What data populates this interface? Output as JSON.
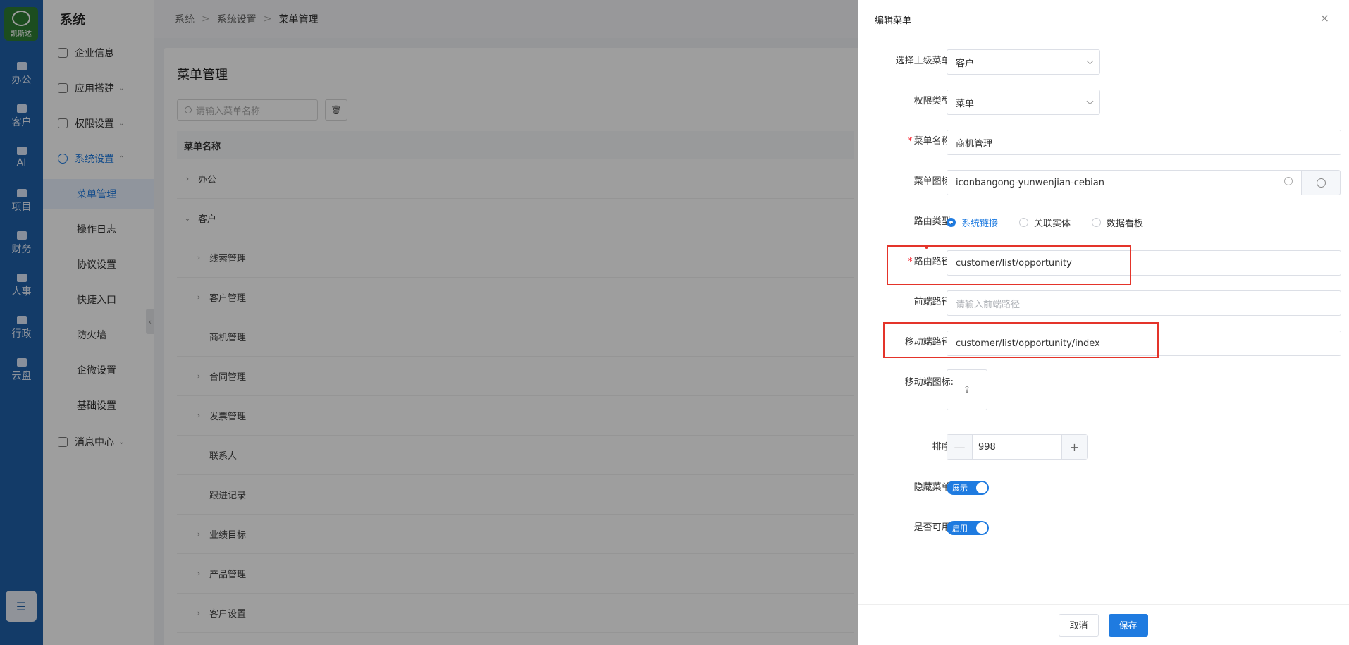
{
  "rail": {
    "logo_text": "凯斯达",
    "items": [
      {
        "label": "办公",
        "icon": "office-icon"
      },
      {
        "label": "客户",
        "icon": "customer-icon"
      },
      {
        "label": "AI",
        "icon": "ai-icon"
      },
      {
        "label": "项目",
        "icon": "folder-icon"
      },
      {
        "label": "财务",
        "icon": "finance-icon"
      },
      {
        "label": "人事",
        "icon": "badge-icon"
      },
      {
        "label": "行政",
        "icon": "admin-icon"
      },
      {
        "label": "云盘",
        "icon": "cloud-icon"
      }
    ],
    "bottom_icon": "menu-config-icon"
  },
  "sidebar": {
    "title": "系统",
    "items": [
      {
        "label": "企业信息",
        "icon": "building-icon"
      },
      {
        "label": "应用搭建",
        "icon": "app-icon",
        "chevron": "⌄"
      },
      {
        "label": "权限设置",
        "icon": "permission-icon",
        "chevron": "⌄"
      },
      {
        "label": "系统设置",
        "icon": "settings-icon",
        "chevron": "⌃"
      },
      {
        "label": "菜单管理"
      },
      {
        "label": "操作日志"
      },
      {
        "label": "协议设置"
      },
      {
        "label": "快捷入口"
      },
      {
        "label": "防火墙"
      },
      {
        "label": "企微设置"
      },
      {
        "label": "基础设置"
      },
      {
        "label": "消息中心",
        "icon": "message-icon",
        "chevron": "⌄"
      }
    ]
  },
  "breadcrumb": {
    "items": [
      "系统",
      "系统设置",
      "菜单管理"
    ],
    "sep": ">"
  },
  "main": {
    "title": "菜单管理",
    "search_placeholder": "请输入菜单名称",
    "column_header": "菜单名称",
    "rows": [
      {
        "label": "办公",
        "arrow": "›"
      },
      {
        "label": "客户",
        "arrow": "⌄"
      },
      {
        "label": "线索管理",
        "arrow": "›"
      },
      {
        "label": "客户管理",
        "arrow": "›"
      },
      {
        "label": "商机管理",
        "arrow": ""
      },
      {
        "label": "合同管理",
        "arrow": "›"
      },
      {
        "label": "发票管理",
        "arrow": "›"
      },
      {
        "label": "联系人",
        "arrow": ""
      },
      {
        "label": "跟进记录",
        "arrow": ""
      },
      {
        "label": "业绩目标",
        "arrow": "›"
      },
      {
        "label": "产品管理",
        "arrow": "›"
      },
      {
        "label": "客户设置",
        "arrow": "›"
      }
    ]
  },
  "drawer": {
    "title": "编辑菜单",
    "close": "×",
    "fields": {
      "parent_menu": {
        "label": "选择上级菜单:",
        "value": "客户"
      },
      "perm_type": {
        "label": "权限类型:",
        "value": "菜单"
      },
      "menu_name": {
        "label": "菜单名称:",
        "value": "商机管理",
        "required": "*"
      },
      "menu_icon": {
        "label": "菜单图标:",
        "value": "iconbangong-yunwenjian-cebian"
      },
      "route_type": {
        "label": "路由类型:",
        "options": [
          "系统链接",
          "关联实体",
          "数据看板"
        ],
        "selected": 0
      },
      "route_path": {
        "label": "路由路径:",
        "value": "customer/list/opportunity",
        "required": "*"
      },
      "frontend_path": {
        "label": "前端路径:",
        "placeholder": "请输入前端路径"
      },
      "mobile_path": {
        "label": "移动端路径:",
        "value": "customer/list/opportunity/index"
      },
      "mobile_icon": {
        "label": "移动端图标:",
        "glyph": "⇪"
      },
      "sort": {
        "label": "排序:",
        "value": "998",
        "minus": "—",
        "plus": "+"
      },
      "hide_menu": {
        "label": "隐藏菜单:",
        "switch_text": "展示"
      },
      "enabled": {
        "label": "是否可用:",
        "switch_text": "启用"
      }
    },
    "buttons": {
      "cancel": "取消",
      "save": "保存"
    }
  },
  "colors": {
    "primary": "#1f7be0",
    "rail": "#1f5fa8",
    "highlight": "#e4342a"
  }
}
